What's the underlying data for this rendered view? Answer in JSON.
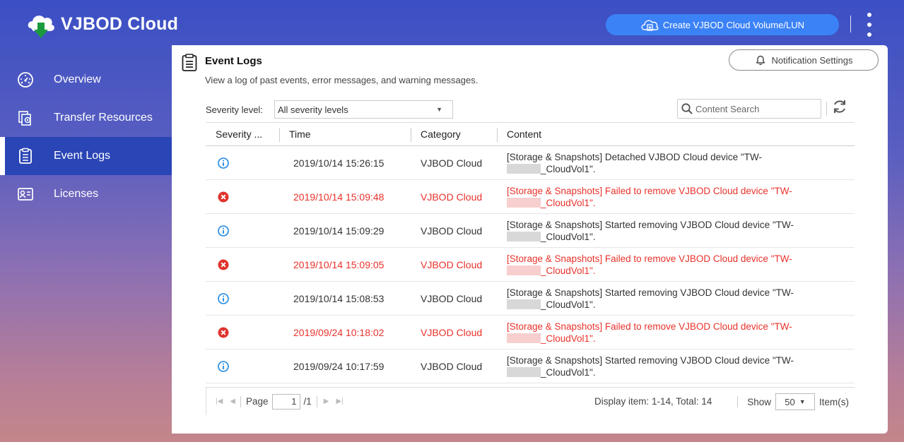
{
  "header": {
    "app_title": "VJBOD Cloud",
    "create_button": "Create VJBOD Cloud Volume/LUN"
  },
  "sidebar": {
    "items": [
      {
        "label": "Overview",
        "icon": "gauge-icon",
        "active": false
      },
      {
        "label": "Transfer Resources",
        "icon": "transfer-resources-icon",
        "active": false
      },
      {
        "label": "Event Logs",
        "icon": "clipboard-list-icon",
        "active": true
      },
      {
        "label": "Licenses",
        "icon": "license-card-icon",
        "active": false
      }
    ]
  },
  "panel": {
    "title": "Event Logs",
    "subtitle": "View a log of past events, error messages, and warning messages.",
    "notification_button": "Notification Settings"
  },
  "filters": {
    "severity_label": "Severity level:",
    "severity_value": "All severity levels",
    "search_placeholder": "Content Search"
  },
  "table": {
    "columns": [
      "Severity ...",
      "Time",
      "Category",
      "Content"
    ],
    "rows": [
      {
        "severity": "info",
        "time": "2019/10/14 15:26:15",
        "category": "VJBOD Cloud",
        "content_line1": "[Storage & Snapshots] Detached VJBOD Cloud device \"TW-",
        "content_line2": "_CloudVol1\"."
      },
      {
        "severity": "error",
        "time": "2019/10/14 15:09:48",
        "category": "VJBOD Cloud",
        "content_line1": "[Storage & Snapshots] Failed to remove VJBOD Cloud device \"TW-",
        "content_line2": "_CloudVol1\"."
      },
      {
        "severity": "info",
        "time": "2019/10/14 15:09:29",
        "category": "VJBOD Cloud",
        "content_line1": "[Storage & Snapshots] Started removing VJBOD Cloud device \"TW-",
        "content_line2": "_CloudVol1\"."
      },
      {
        "severity": "error",
        "time": "2019/10/14 15:09:05",
        "category": "VJBOD Cloud",
        "content_line1": "[Storage & Snapshots] Failed to remove VJBOD Cloud device \"TW-",
        "content_line2": "_CloudVol1\"."
      },
      {
        "severity": "info",
        "time": "2019/10/14 15:08:53",
        "category": "VJBOD Cloud",
        "content_line1": "[Storage & Snapshots] Started removing VJBOD Cloud device \"TW-",
        "content_line2": "_CloudVol1\"."
      },
      {
        "severity": "error",
        "time": "2019/09/24 10:18:02",
        "category": "VJBOD Cloud",
        "content_line1": "[Storage & Snapshots] Failed to remove VJBOD Cloud device \"TW-",
        "content_line2": "_CloudVol1\"."
      },
      {
        "severity": "info",
        "time": "2019/09/24 10:17:59",
        "category": "VJBOD Cloud",
        "content_line1": "[Storage & Snapshots] Started removing VJBOD Cloud device \"TW-",
        "content_line2": "_CloudVol1\"."
      }
    ]
  },
  "pager": {
    "page_label": "Page",
    "page_value": "1",
    "page_total": "/1",
    "display_text": "Display item: 1-14, Total: 14",
    "show_label": "Show",
    "show_value": "50",
    "items_label": "Item(s)"
  },
  "colors": {
    "accent": "#3b82f6",
    "sidebar_active": "#2a45b5",
    "error": "#e8322b",
    "info": "#1e88e5"
  }
}
